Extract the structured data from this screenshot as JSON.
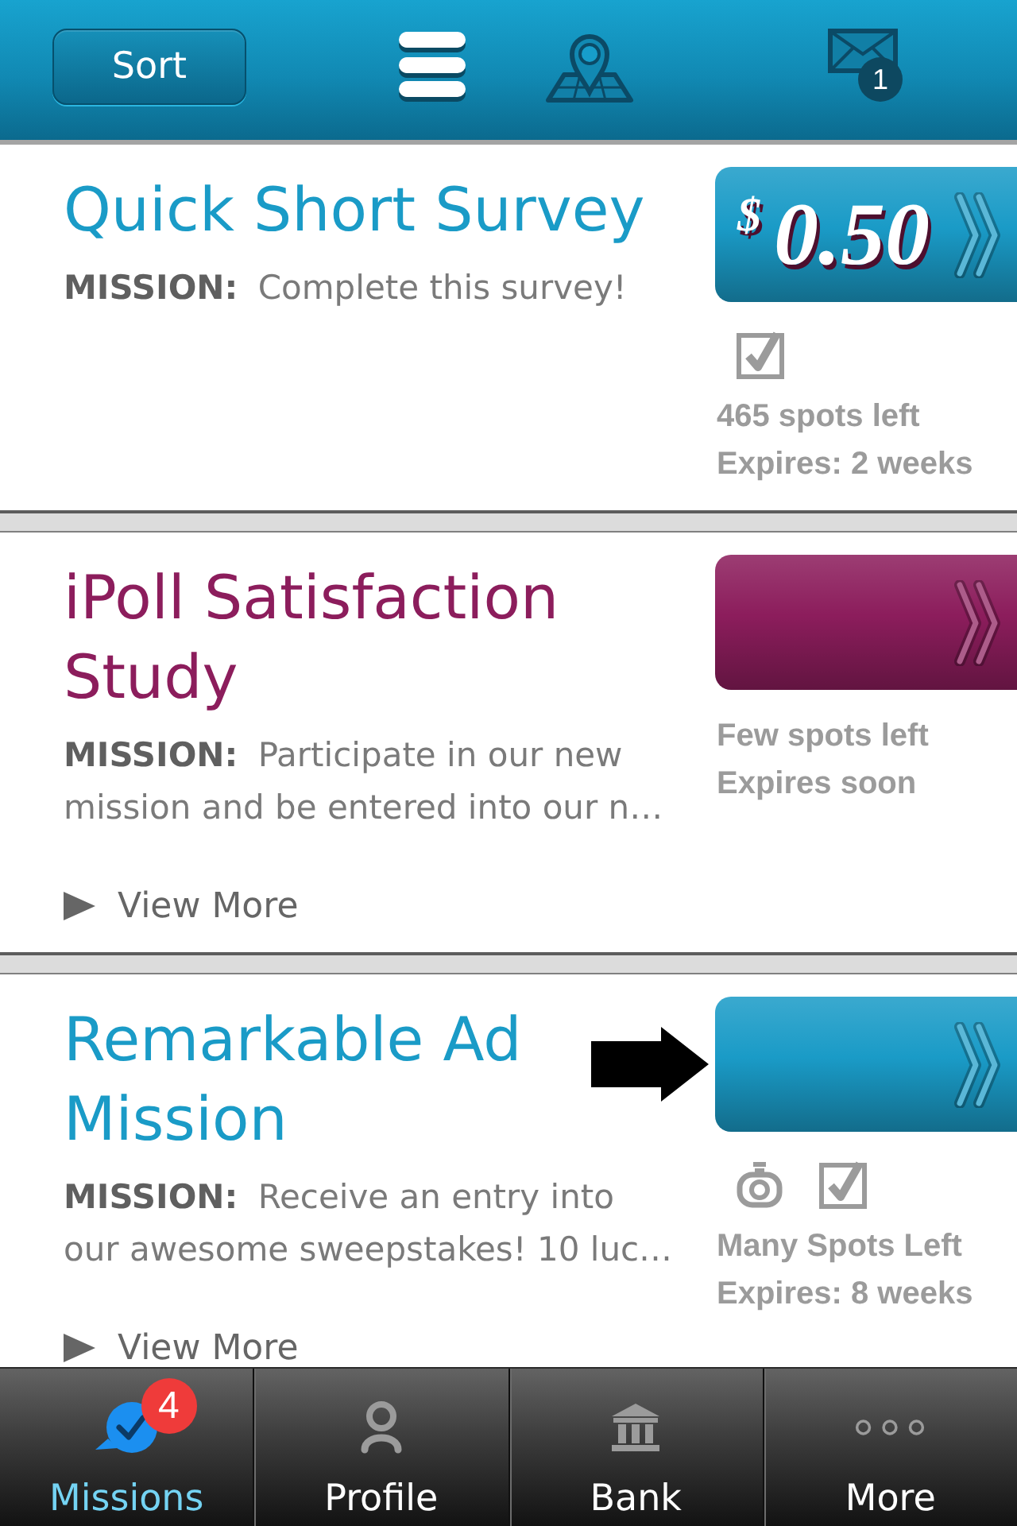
{
  "header": {
    "sort_button": "Sort",
    "mail_badge": "1"
  },
  "missions": [
    {
      "title": "Quick Short Survey",
      "color": "#1a9bc7",
      "description": "**MISSION:** Complete this survey!",
      "price": {
        "currency": "$",
        "amount": "0.50"
      },
      "icons": [
        {
          "kind": "check"
        }
      ],
      "spots": "465 spots left",
      "expires": "Expires: 2 weeks",
      "pointer_arrow": false
    },
    {
      "title": "iPoll Satisfaction Study",
      "color": "#8c1d5c",
      "description": "**MISSION:** Participate in our new mission and be entered into our n…",
      "spots": "Few spots left",
      "expires": "Expires soon",
      "view_more": "View More",
      "pointer_arrow": false
    },
    {
      "title": "Remarkable Ad Mission",
      "color": "#1a9bc7",
      "description": "**MISSION:** Receive an entry into our awesome sweepstakes! 10 luc…",
      "icons": [
        {
          "kind": "photo"
        },
        {
          "kind": "check"
        }
      ],
      "spots": "Many Spots Left",
      "expires": "Expires: 8 weeks",
      "view_more": "View More",
      "pointer_arrow": true
    }
  ],
  "tabs": [
    {
      "label": "Missions",
      "selected": true,
      "badge": "4"
    },
    {
      "label": "Profile",
      "selected": false
    },
    {
      "label": "Bank",
      "selected": false
    },
    {
      "label": "More",
      "selected": false
    }
  ]
}
